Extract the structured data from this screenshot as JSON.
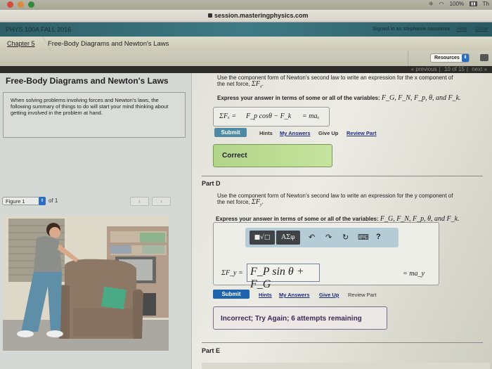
{
  "system": {
    "status_battery": "100%",
    "status_extra": "Th"
  },
  "browser": {
    "url": "session.masteringphysics.com"
  },
  "header": {
    "course": "PHYS 100A FALL 2016",
    "signed_in": "Signed in as stephanie casanova",
    "help": "Help",
    "close": "Close"
  },
  "breadcrumb": {
    "chapter": "Chapter 5",
    "title": "Free-Body Diagrams and Newton's Laws"
  },
  "tools": {
    "resources_label": "Resources"
  },
  "nav": {
    "previous": "« previous",
    "position": "10 of 15",
    "next": "next »"
  },
  "left": {
    "title": "Free-Body Diagrams and Newton's Laws",
    "intro": "When solving problems involving forces and Newton's laws, the following summary of things to do will start your mind thinking about getting involved in the problem at hand.",
    "figure_select": "Figure 1",
    "figure_of": "of 1",
    "prev_btn": "‹",
    "next_btn": "›"
  },
  "partC": {
    "question_1": "Use the component form of Newton's second law to write an expression for the x component of",
    "question_2a": "the net force, ",
    "question_2_math": "ΣF",
    "question_2_sub": "x",
    "express_label": "Express your answer in terms of some or all of the variables: ",
    "variables": "F_G, F_N, F_p, θ, and F_k.",
    "answer_lhs": "ΣFₓ =",
    "answer_value": "F_p cosθ − F_k",
    "answer_rhs": "= maₓ",
    "submit": "Submit",
    "hints": "Hints",
    "my_answers": "My Answers",
    "give_up": "Give Up",
    "review_part": "Review Part",
    "result": "Correct"
  },
  "partD": {
    "label": "Part D",
    "question_1": "Use the component form of Newton's second law to write an expression for the y component of",
    "question_2a": "the net force, ",
    "question_2_math": "ΣF",
    "question_2_sub": "y",
    "express_label": "Express your answer in terms of some or all of the variables: ",
    "variables": "F_G, F_N, F_p, θ, and F_k.",
    "toolbar": {
      "templates": "■√□",
      "symbols": "ΑΣφ",
      "undo": "↶",
      "redo": "↷",
      "reset": "↻",
      "keyboard": "⌨",
      "help": "?"
    },
    "answer_lhs": "ΣF_y =",
    "answer_value": "F_P sin θ + F_G",
    "answer_rhs": "= ma_y",
    "submit": "Submit",
    "hints": "Hints",
    "my_answers": "My Answers",
    "give_up": "Give Up",
    "review_part": "Review Part",
    "result": "Incorrect; Try Again; 6 attempts remaining"
  },
  "partE": {
    "label": "Part E"
  },
  "colors": {
    "submit_c": "#4e8aa6",
    "submit_d": "#1e63ad",
    "correct": "#b3d58a",
    "header": "#3e7a85"
  }
}
